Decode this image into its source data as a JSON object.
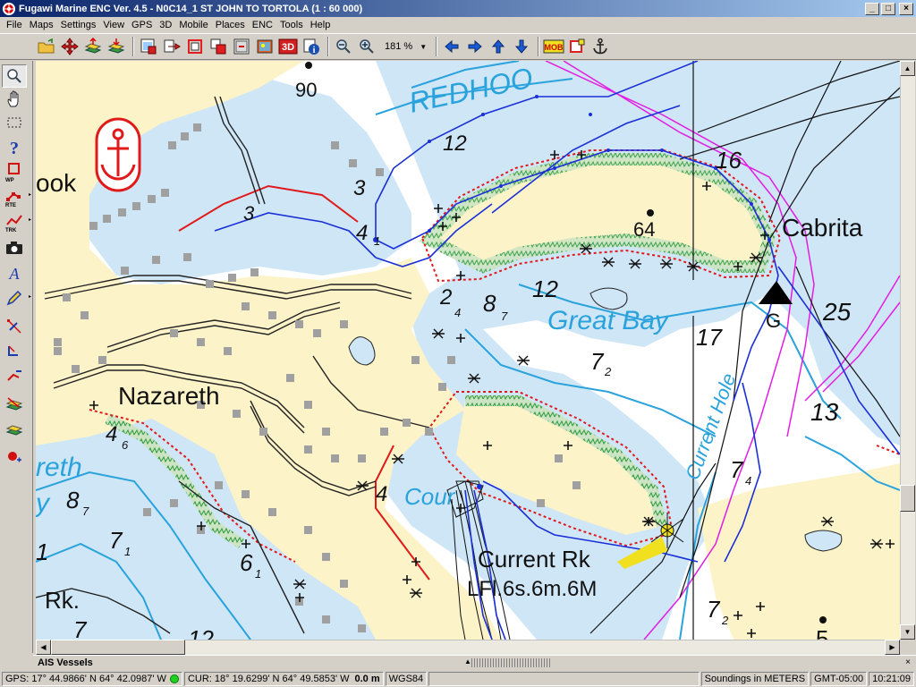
{
  "window": {
    "title": "Fugawi Marine ENC Ver. 4.5 - N0C14_1  ST JOHN TO TORTOLA  (1 : 60 000)",
    "minimize": "_",
    "maximize": "□",
    "close": "×"
  },
  "menu": [
    "File",
    "Maps",
    "Settings",
    "View",
    "GPS",
    "3D",
    "Mobile",
    "Places",
    "ENC",
    "Tools",
    "Help"
  ],
  "toolbar": {
    "zoom_level": "181 %",
    "mob_label": "MOB",
    "label_3d": "3D"
  },
  "leftbar": {
    "wp_label": "WP",
    "rte_label": "RTE",
    "trk_label": "TRK"
  },
  "chart": {
    "place_names": {
      "nazareth": "Nazareth",
      "great_bay": "Great Bay",
      "cabrita": "Cabrita",
      "current_rk": "Current Rk",
      "current_rk_light": "LFl.6s.6m.6M",
      "redhook": "REDHOO",
      "current_hole": "Current Hole",
      "cours": "Cour",
      "brook": "ook",
      "rk": "Rk.",
      "reth": "reth",
      "ay": "y",
      "g": "G"
    },
    "soundings": {
      "s90": "90",
      "s12a": "12",
      "s3": "3",
      "s4": "4",
      "s1": "1",
      "s2": "2",
      "s16": "16",
      "s64": "64",
      "s12b": "12",
      "s8": "8",
      "s7": "7",
      "s17": "17",
      "s25": "25",
      "s13": "13",
      "s72": "7",
      "s46": "4",
      "s6": "6",
      "s87": "8",
      "s71": "7",
      "s61": "6",
      "s11": "1",
      "s4b": "4",
      "s74": "7",
      "s72b": "7",
      "s72c": "7",
      "s12c": "12",
      "s5": "5"
    }
  },
  "ais": {
    "title": "AIS Vessels",
    "close": "×"
  },
  "status": {
    "gps": "GPS: 17° 44.9866' N 64° 42.0987' W",
    "cur": "CUR: 18° 19.6299' N 64° 49.5853' W",
    "dist": "0.0 m",
    "datum": "WGS84",
    "soundings": "Soundings in METERS",
    "tz": "GMT-05:00",
    "time": "10:21:09"
  },
  "colors": {
    "land": "#fdf3c8",
    "shallow": "#cfe6f7",
    "deep": "#ffffff",
    "track_blue": "#1a2fd6",
    "route_magenta": "#e11ee1",
    "depth_contour": "#2aa3dd",
    "danger_red": "#e01a1a",
    "reef_green": "#cde4c4"
  }
}
